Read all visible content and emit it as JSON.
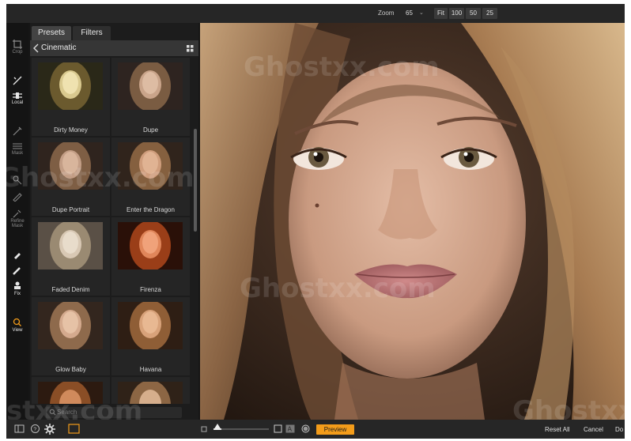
{
  "topbar": {
    "zoom_label": "Zoom",
    "zoom_value": "65",
    "zoom_presets": [
      "Fit",
      "100",
      "50",
      "25"
    ]
  },
  "rail": {
    "tools": [
      {
        "label": "Crop",
        "icon": "crop-icon"
      },
      {
        "label": "",
        "icon": "brush-icon"
      },
      {
        "label": "Local",
        "icon": "local-adjust-icon"
      },
      {
        "label": "",
        "icon": "pen-icon"
      },
      {
        "label": "Mask",
        "icon": "mask-icon"
      },
      {
        "label": "",
        "icon": "refine-brush-icon"
      },
      {
        "label": "",
        "icon": "refine-eraser-icon"
      },
      {
        "label": "Refine Mask",
        "icon": "refine-mask-icon"
      },
      {
        "label": "",
        "icon": "retouch-brush-icon"
      },
      {
        "label": "",
        "icon": "heal-icon"
      },
      {
        "label": "Fix",
        "icon": "clone-stamp-icon"
      },
      {
        "label": "View",
        "icon": "magnifier-icon"
      }
    ]
  },
  "panel": {
    "tabs": [
      "Presets",
      "Filters"
    ],
    "category": "Cinematic",
    "presets": [
      "Dirty Money",
      "Dupe",
      "Dupe Portrait",
      "Enter the Dragon",
      "Faded Denim",
      "Firenza",
      "Glow Baby",
      "Havana",
      "",
      ""
    ],
    "search_placeholder": "Search"
  },
  "watermarks": [
    "Ghostxx.com",
    "Ghostxx.com",
    "Ghostxx.com",
    "Ghostxx.com",
    "stxx.com"
  ],
  "bottombar": {
    "preview_label": "Preview",
    "reset_label": "Reset All",
    "cancel_label": "Cancel",
    "done_label": "Do"
  },
  "colors": {
    "accent": "#f39c1a",
    "background": "#161616",
    "panel": "#1c1c1c"
  }
}
